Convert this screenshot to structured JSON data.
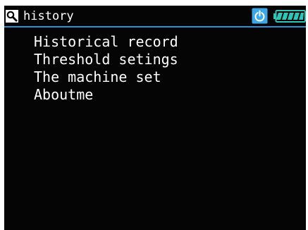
{
  "header": {
    "title": "history",
    "icons": {
      "left": "search-icon",
      "power": "power-icon",
      "battery": "battery-icon"
    }
  },
  "menu": {
    "items": [
      {
        "label": "Historical record"
      },
      {
        "label": "Threshold setings"
      },
      {
        "label": "The machine set"
      },
      {
        "label": "Aboutme"
      }
    ]
  },
  "colors": {
    "background": "#050505",
    "text": "#ffffff",
    "divider": "#2b8fd6",
    "battery": "#2ec6b8",
    "power": "#3aa7e8"
  }
}
